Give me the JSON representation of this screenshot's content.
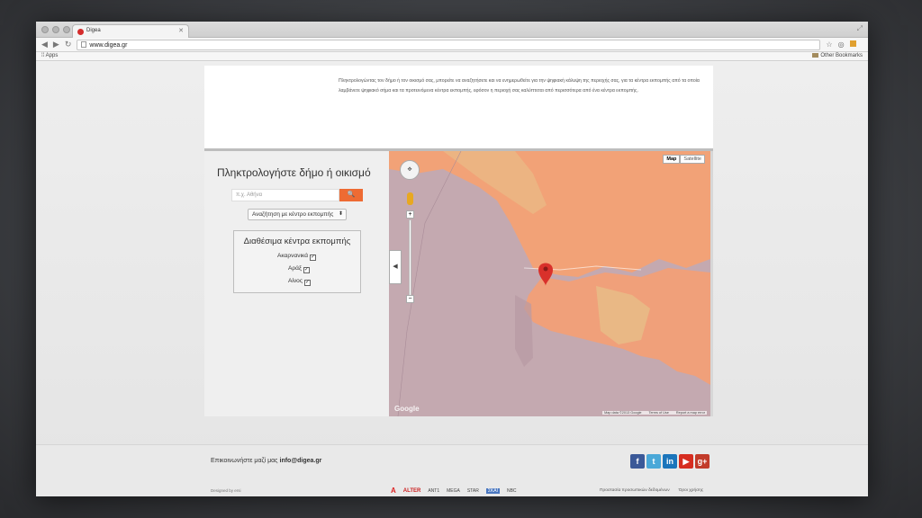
{
  "browser": {
    "tab_title": "Digea",
    "url": "www.digea.gr",
    "bookmarks_apps": "Apps",
    "bookmarks_other": "Other Bookmarks"
  },
  "intro": {
    "text": "Πληκτρολογώντας τον δήμο ή τον οικισμό σας, μπορείτε να αναζητήσετε και να ενημερωθείτε για την ψηφιακή κάλυψη της περιοχής σας, για τα κέντρα εκπομπής από τα οποία λαμβάνετε ψηφιακό σήμα και τα προτεινόμενα κέντρα εκπομπής, εφόσον η περιοχή σας καλύπτεται από περισσότερα από ένα κέντρα εκπομπής."
  },
  "search": {
    "heading": "Πληκτρολογήστε δήμο ή οικισμό",
    "placeholder": "π.χ. Αθήνα",
    "button_icon": "search-icon",
    "mode_select": "Αναζήτηση με κέντρο εκπομπής"
  },
  "available": {
    "heading": "Διαθέσιμα κέντρα εκπομπής",
    "items": [
      {
        "label": "Ακαρνανικά",
        "checked": true
      },
      {
        "label": "Αράξ",
        "checked": true
      },
      {
        "label": "Αίνος",
        "checked": true
      }
    ]
  },
  "map": {
    "type_map": "Map",
    "type_satellite": "Satellite",
    "google": "Google",
    "attrib_data": "Map data ©2013 Google",
    "attrib_terms": "Terms of Use",
    "attrib_report": "Report a map error",
    "colors": {
      "coverage": "#f2a277",
      "sea": "#c4a9b0",
      "land": "#e8d7a6"
    }
  },
  "footer": {
    "contact_prefix": "Επικοινωνήστε μαζί μας",
    "contact_email": "info@digea.gr",
    "designed_by": "Designed by",
    "designer": "ersi",
    "logos": [
      "A",
      "ALTER",
      "ANT1",
      "MEGA",
      "STAR",
      "ΣΚΑΪ",
      "NBC"
    ],
    "link_privacy": "Προστασία προσωπικών δεδομένων",
    "link_terms": "Όροι χρήσης",
    "social": [
      {
        "name": "facebook-icon",
        "glyph": "f",
        "color": "#3b5998"
      },
      {
        "name": "twitter-icon",
        "glyph": "t",
        "color": "#4aa8d8"
      },
      {
        "name": "linkedin-icon",
        "glyph": "in",
        "color": "#1b75bb"
      },
      {
        "name": "youtube-icon",
        "glyph": "▶",
        "color": "#d62d20"
      },
      {
        "name": "googleplus-icon",
        "glyph": "g+",
        "color": "#c23b2a"
      }
    ]
  }
}
